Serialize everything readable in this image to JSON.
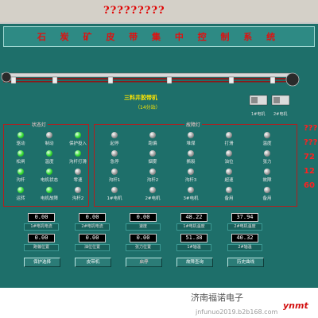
{
  "window_title": "?????????",
  "system_title": "石 炭 矿 皮 带 集 中 控 制 系 统",
  "belt": {
    "name": "三料井胶带机",
    "sub": "（14分站）",
    "motor1_label": "1#电机",
    "motor2_label": "2#电机"
  },
  "status_panel": {
    "title": "状态灯",
    "lamps": [
      {
        "label": "驱动",
        "on": true
      },
      {
        "label": "制动",
        "on": false
      },
      {
        "label": "保护投入",
        "on": true
      },
      {
        "label": "松闸",
        "on": true
      },
      {
        "label": "温度",
        "on": true
      },
      {
        "label": "沟杆打滑",
        "on": true
      },
      {
        "label": "沟杆",
        "on": true
      },
      {
        "label": "电机状态",
        "on": true
      },
      {
        "label": "零速",
        "on": false
      },
      {
        "label": "运转",
        "on": true
      },
      {
        "label": "电机故障",
        "on": true
      },
      {
        "label": "沟杆2",
        "on": false
      }
    ]
  },
  "fault_panel": {
    "title": "故障灯",
    "lamps": [
      {
        "label": "起停",
        "on": false
      },
      {
        "label": "跑偏",
        "on": false
      },
      {
        "label": "堆煤",
        "on": false
      },
      {
        "label": "打滑",
        "on": false
      },
      {
        "label": "温度",
        "on": false
      },
      {
        "label": "急停",
        "on": false
      },
      {
        "label": "烟雾",
        "on": false
      },
      {
        "label": "撕裂",
        "on": false
      },
      {
        "label": "油位",
        "on": false
      },
      {
        "label": "张力",
        "on": false
      },
      {
        "label": "沟杆1",
        "on": false
      },
      {
        "label": "沟杆2",
        "on": false
      },
      {
        "label": "沟杆3",
        "on": false
      },
      {
        "label": "超速",
        "on": false
      },
      {
        "label": "故障",
        "on": false
      },
      {
        "label": "1#电机",
        "on": false
      },
      {
        "label": "2#电机",
        "on": false
      },
      {
        "label": "3#电机",
        "on": false
      },
      {
        "label": "备用",
        "on": false
      },
      {
        "label": "备用",
        "on": false
      }
    ]
  },
  "side_numbers": [
    "???",
    "???",
    "72",
    "12",
    "60"
  ],
  "readouts": [
    {
      "value": "0.00",
      "label": "1#电机电流"
    },
    {
      "value": "0.00",
      "label": "2#电机电流"
    },
    {
      "value": "0.00",
      "label": "速度"
    },
    {
      "value": "48.22",
      "label": "1#电机温度"
    },
    {
      "value": "37.94",
      "label": "2#电机温度"
    },
    {
      "value": "0.00",
      "label": "跑偏位置"
    },
    {
      "value": "0.00",
      "label": "油位位置"
    },
    {
      "value": "0.00",
      "label": "张力位置"
    },
    {
      "value": "51.38",
      "label": "1#轴温"
    },
    {
      "value": "40.32",
      "label": "2#轴温"
    }
  ],
  "buttons": [
    {
      "label": "保护选择",
      "red": false
    },
    {
      "label": "皮带机",
      "red": false
    },
    {
      "label": "启停",
      "red": true
    },
    {
      "label": "故障查询",
      "red": false
    },
    {
      "label": "历史曲线",
      "red": false
    }
  ],
  "watermark": {
    "cn": "济南福诺电子",
    "url": "jnfunuo2019.b2b168.com",
    "logo": "ynmt"
  }
}
